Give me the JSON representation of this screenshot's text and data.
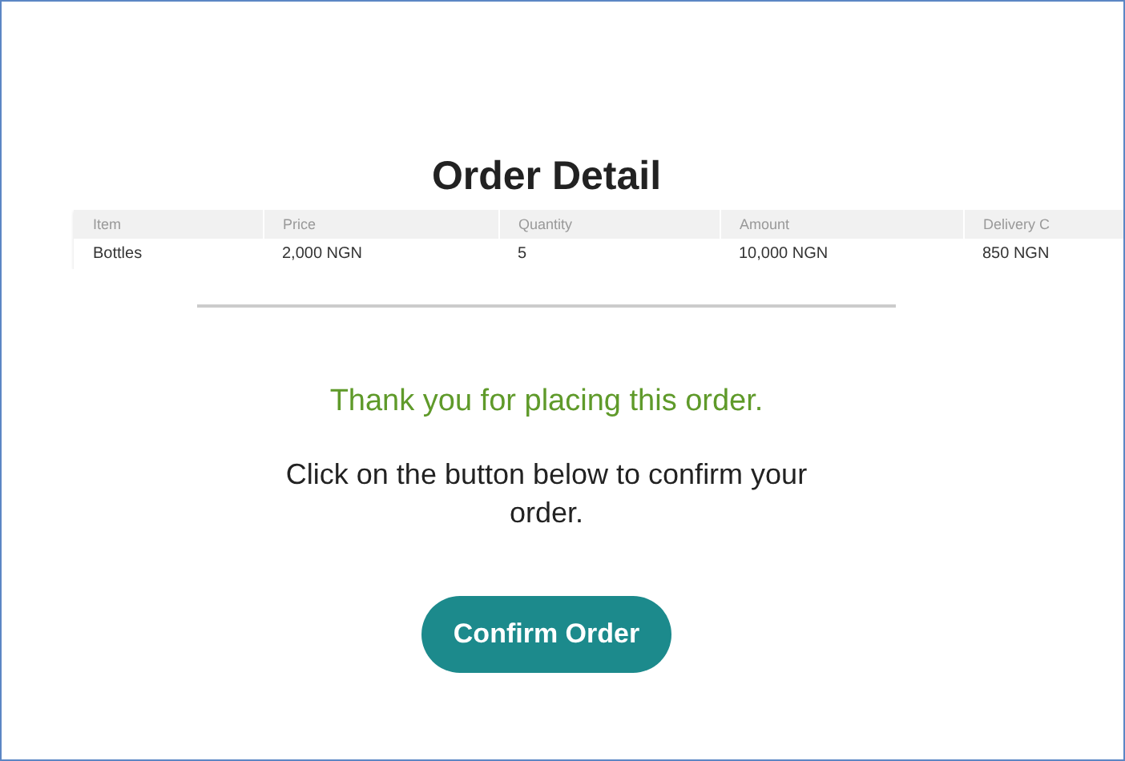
{
  "title": "Order Detail",
  "table": {
    "columns": [
      "Item",
      "Price",
      "Quantity",
      "Amount",
      "Delivery C"
    ],
    "rows": [
      [
        "Bottles",
        "2,000 NGN",
        "5",
        "10,000 NGN",
        "850 NGN"
      ]
    ]
  },
  "thank_you": "Thank you for placing this order.",
  "instruction": "Click on the button below to confirm your order.",
  "confirm_button": "Confirm Order"
}
